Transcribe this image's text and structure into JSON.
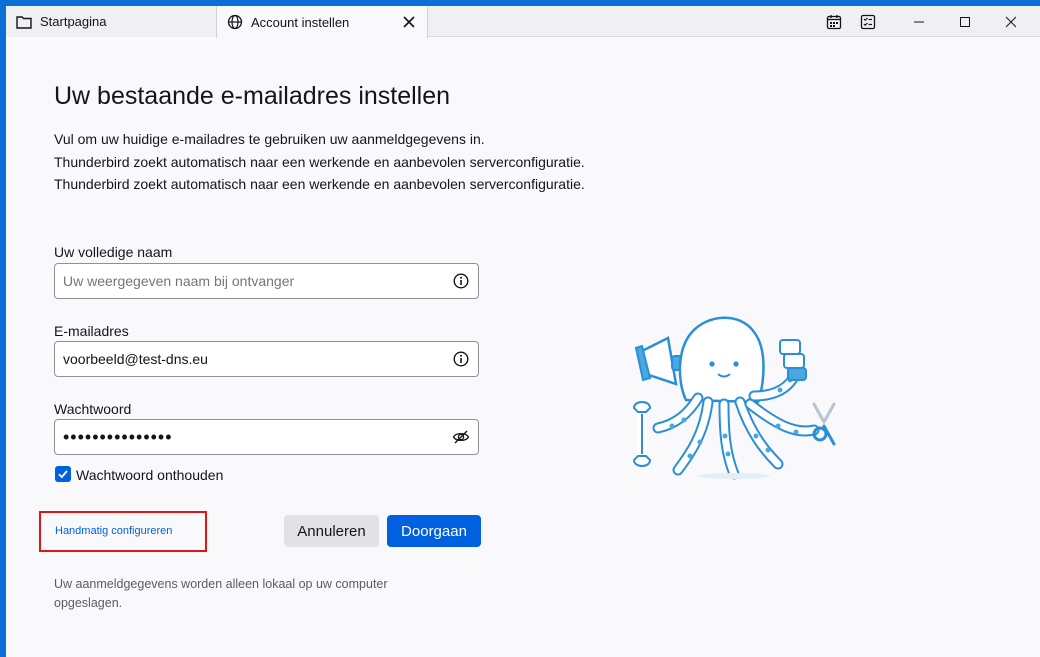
{
  "tabs": [
    {
      "label": "Startpagina",
      "icon": "folder-icon"
    },
    {
      "label": "Account instellen",
      "icon": "globe-icon"
    }
  ],
  "toolbar_icons": [
    "calendar-icon",
    "tasks-icon"
  ],
  "window_controls": [
    "minimize-icon",
    "maximize-icon",
    "close-icon"
  ],
  "page": {
    "title": "Uw bestaande e-mailadres instellen",
    "desc_line1": "Vul om uw huidige e-mailadres te gebruiken uw aanmeldgegevens in.",
    "desc_line2": "Thunderbird zoekt automatisch naar een werkende en aanbevolen serverconfiguratie.",
    "desc_line3": "Thunderbird zoekt automatisch naar een werkende en aanbevolen serverconfiguratie."
  },
  "form": {
    "name_label": "Uw volledige naam",
    "name_placeholder": "Uw weergegeven naam bij ontvanger",
    "email_label": "E-mailadres",
    "email_value": "voorbeeld@test-dns.eu",
    "password_label": "Wachtwoord",
    "password_value": "passwordpasswor",
    "remember_label": "Wachtwoord onthouden",
    "remember_checked": true
  },
  "actions": {
    "manual_link": "Handmatig configureren",
    "cancel_label": "Annuleren",
    "continue_label": "Doorgaan"
  },
  "note": "Uw aanmeldgegevens worden alleen lokaal op uw computer opgeslagen.",
  "colors": {
    "accent": "#0061e0",
    "highlight": "#e01515",
    "mascot": "#4aa8e0"
  }
}
